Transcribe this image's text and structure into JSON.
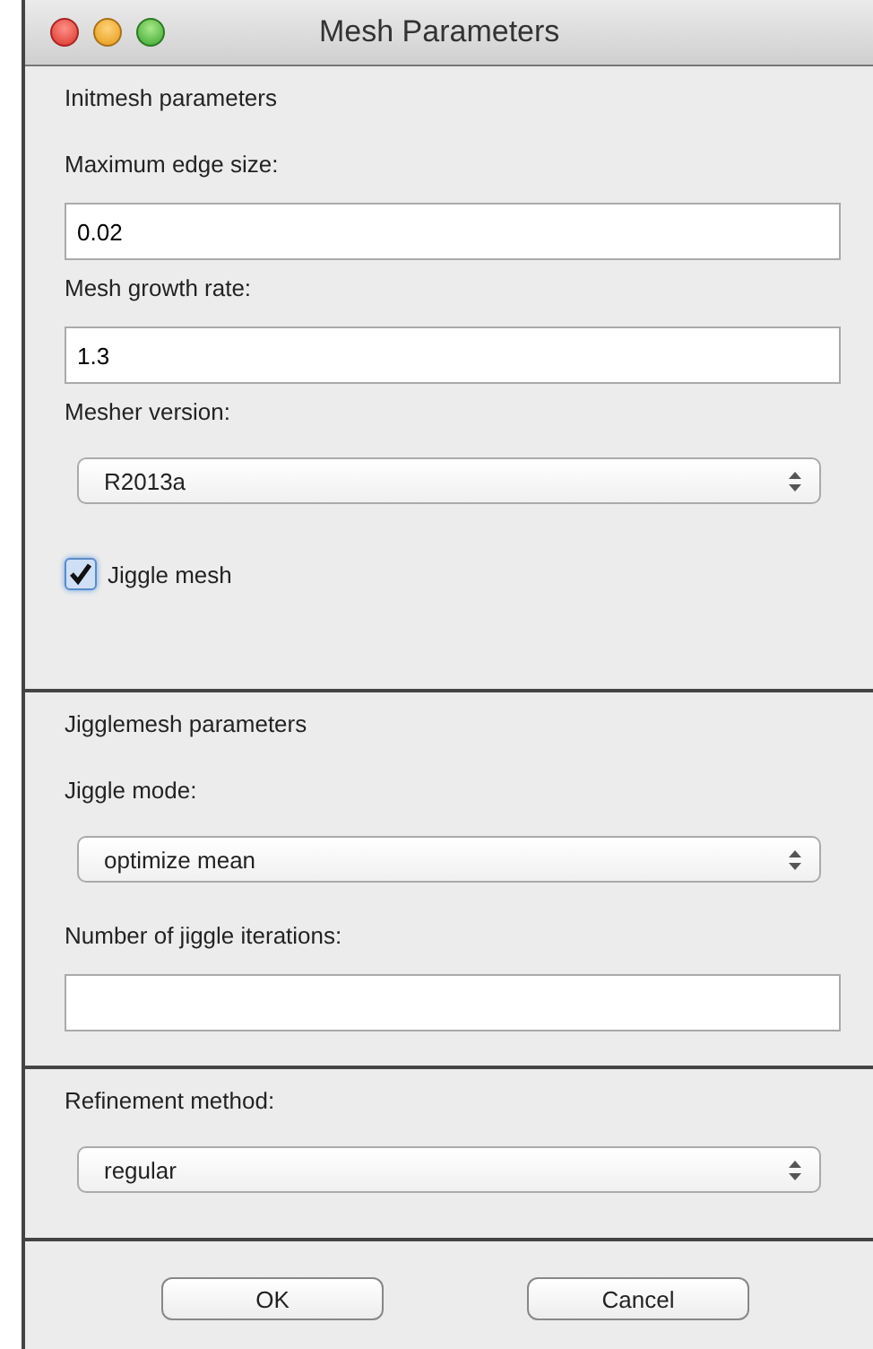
{
  "window": {
    "title": "Mesh Parameters"
  },
  "sections": [
    {
      "title": "Initmesh parameters",
      "items": [
        {
          "kind": "field",
          "label": "Maximum edge size:",
          "value": "0.02"
        },
        {
          "kind": "field",
          "label": "Mesh growth rate:",
          "value": "1.3"
        },
        {
          "kind": "select",
          "label": "Mesher version:",
          "value": "R2013a"
        },
        {
          "kind": "checkbox",
          "label": "Jiggle mesh",
          "checked": true
        }
      ]
    },
    {
      "title": "Jigglemesh parameters",
      "items": [
        {
          "kind": "select",
          "label": "Jiggle mode:",
          "value": "optimize mean"
        },
        {
          "kind": "field",
          "label": "Number of jiggle iterations:"
        }
      ]
    },
    {
      "items": [
        {
          "kind": "select",
          "label": "Refinement method:",
          "value": "regular"
        }
      ]
    }
  ],
  "buttons": [
    "OK",
    "Cancel"
  ]
}
